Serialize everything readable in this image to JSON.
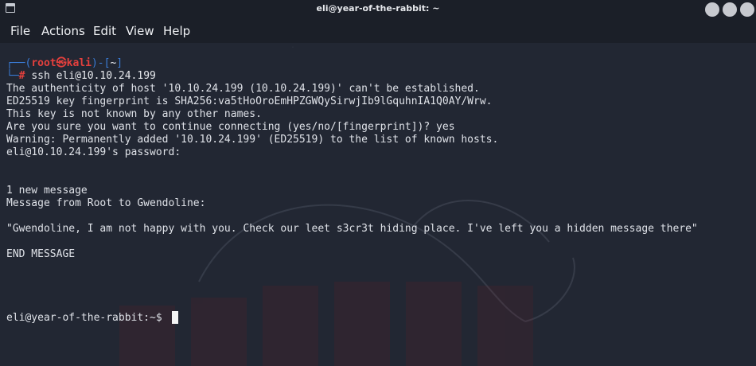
{
  "window": {
    "title": "eli@year-of-the-rabbit: ~"
  },
  "menu": {
    "file": "File",
    "actions": "Actions",
    "edit": "Edit",
    "view": "View",
    "help": "Help"
  },
  "prompt": {
    "open": "┌──(",
    "user": "root",
    "at": "㉿",
    "host": "kali",
    "mid": ")-[",
    "dir": "~",
    "close": "]",
    "arrow": "└─",
    "hash": "#",
    "command": "ssh eli@10.10.24.199"
  },
  "output": {
    "l1": "The authenticity of host '10.10.24.199 (10.10.24.199)' can't be established.",
    "l2": "ED25519 key fingerprint is SHA256:va5tHoOroEmHPZGWQySirwjIb9lGquhnIA1Q0AY/Wrw.",
    "l3": "This key is not known by any other names.",
    "l4": "Are you sure you want to continue connecting (yes/no/[fingerprint])? yes",
    "l5": "Warning: Permanently added '10.10.24.199' (ED25519) to the list of known hosts.",
    "l6": "eli@10.10.24.199's password:",
    "l7": "1 new message",
    "l8": "Message from Root to Gwendoline:",
    "l9": "\"Gwendoline, I am not happy with you. Check our leet s3cr3t hiding place. I've left you a hidden message there\"",
    "l10": "END MESSAGE",
    "l11": "eli@year-of-the-rabbit:~$ "
  }
}
